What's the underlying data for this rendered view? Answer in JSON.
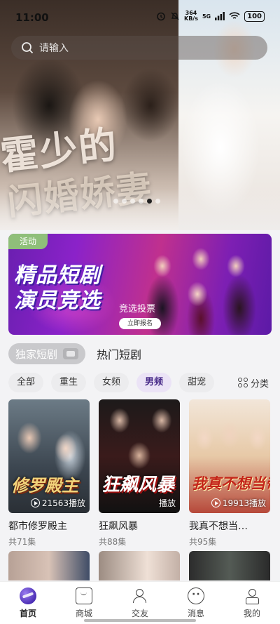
{
  "status_bar": {
    "time": "11:00",
    "net_speed": "364",
    "net_unit": "KB/s",
    "signal": "5G",
    "battery": "100"
  },
  "search": {
    "placeholder": "请输入",
    "icon": "search-icon"
  },
  "hero": {
    "carousel_dots": 6,
    "active_dot": 4,
    "calligraphy_line1": "霍少的",
    "calligraphy_line2": "闪婚娇妻"
  },
  "banner": {
    "tag": "活动",
    "title_line1": "精品短剧",
    "title_line2": "演员竞选",
    "vote_text": "竞选投票",
    "signup_button": "立即报名"
  },
  "main_tabs": [
    {
      "label": "独家短剧",
      "active": true,
      "icon": "tv-icon"
    },
    {
      "label": "热门短剧",
      "active": false
    }
  ],
  "categories": [
    {
      "label": "全部",
      "active": false
    },
    {
      "label": "重生",
      "active": false
    },
    {
      "label": "女频",
      "active": false
    },
    {
      "label": "男频",
      "active": true
    },
    {
      "label": "甜宠",
      "active": false
    }
  ],
  "classify": {
    "label": "分类",
    "icon": "grid-icon"
  },
  "dramas": [
    {
      "poster_title": "修罗殿主",
      "plays": "21563播放",
      "name": "都市修罗殿主",
      "episodes": "共71集"
    },
    {
      "poster_title": "狂飙风暴",
      "plays": "播放",
      "name": "狂飙风暴",
      "episodes": "共88集"
    },
    {
      "poster_title": "我真不想当帝师啊",
      "plays": "19913播放",
      "name": "我真不想当…",
      "episodes": "共95集"
    }
  ],
  "bottom_nav": [
    {
      "label": "首页",
      "icon": "home-icon",
      "active": true
    },
    {
      "label": "商城",
      "icon": "shopping-bag-icon",
      "active": false
    },
    {
      "label": "交友",
      "icon": "friends-icon",
      "active": false
    },
    {
      "label": "消息",
      "icon": "message-icon",
      "active": false
    },
    {
      "label": "我的",
      "icon": "profile-icon",
      "active": false
    }
  ],
  "colors": {
    "accent": "#4a2d8a",
    "active_chip_bg": "#ebe3f6",
    "banner_tag": "#8fbf7a"
  }
}
